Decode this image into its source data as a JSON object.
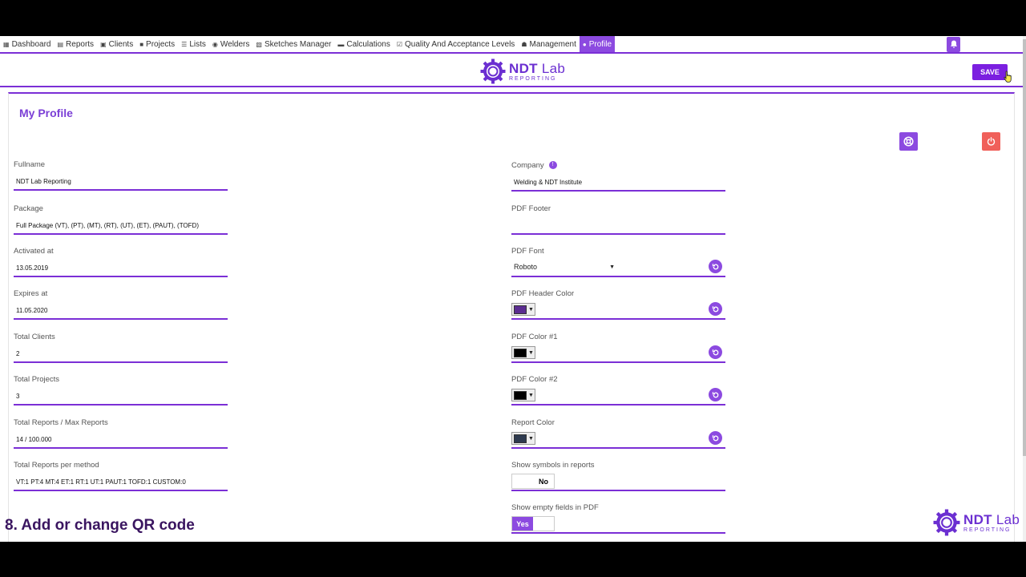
{
  "nav": {
    "items": [
      {
        "label": "Dashboard",
        "icon": "dashboard-icon",
        "active": false
      },
      {
        "label": "Reports",
        "icon": "reports-icon",
        "active": false
      },
      {
        "label": "Clients",
        "icon": "clients-icon",
        "active": false
      },
      {
        "label": "Projects",
        "icon": "projects-icon",
        "active": false
      },
      {
        "label": "Lists",
        "icon": "lists-icon",
        "active": false
      },
      {
        "label": "Welders",
        "icon": "welders-icon",
        "active": false
      },
      {
        "label": "Sketches Manager",
        "icon": "sketches-icon",
        "active": false
      },
      {
        "label": "Calculations",
        "icon": "calculations-icon",
        "active": false
      },
      {
        "label": "Quality And Acceptance Levels",
        "icon": "quality-icon",
        "active": false
      },
      {
        "label": "Management",
        "icon": "management-icon",
        "active": false
      },
      {
        "label": "Profile",
        "icon": "user-icon",
        "active": true
      }
    ],
    "bell_icon": "bell-icon"
  },
  "header": {
    "logo_main_bold": "NDT",
    "logo_main_light": " Lab",
    "logo_sub": "REPORTING",
    "save_label": "SAVE"
  },
  "page": {
    "title": "My Profile"
  },
  "left_fields": {
    "fullname": {
      "label": "Fullname",
      "value": "NDT Lab Reporting"
    },
    "package": {
      "label": "Package",
      "value": "Full Package (VT), (PT), (MT), (RT), (UT), (ET), (PAUT), (TOFD)"
    },
    "activated": {
      "label": "Activated at",
      "value": "13.05.2019"
    },
    "expires": {
      "label": "Expires at",
      "value": "11.05.2020"
    },
    "clients": {
      "label": "Total Clients",
      "value": "2"
    },
    "projects": {
      "label": "Total Projects",
      "value": "3"
    },
    "reports": {
      "label": "Total Reports / Max Reports",
      "value": "14 / 100.000"
    },
    "per_method": {
      "label": "Total Reports per method",
      "value": "VT:1 PT:4 MT:4 ET:1 RT:1 UT:1 PAUT:1 TOFD:1 CUSTOM:0"
    }
  },
  "right_fields": {
    "company": {
      "label": "Company",
      "value": "Welding & NDT Institute",
      "info": "!"
    },
    "pdf_footer": {
      "label": "PDF Footer",
      "value": ""
    },
    "pdf_font": {
      "label": "PDF Font",
      "value": "Roboto"
    },
    "header_color": {
      "label": "PDF Header Color",
      "color": "#5b2c91"
    },
    "color1": {
      "label": "PDF Color #1",
      "color": "#000000"
    },
    "color2": {
      "label": "PDF Color #2",
      "color": "#000000"
    },
    "report_color": {
      "label": "Report Color",
      "color": "#2e3a4f"
    },
    "show_symbols": {
      "label": "Show symbols in reports",
      "state_label": "No",
      "on": false
    },
    "show_empty": {
      "label": "Show empty fields in PDF",
      "state_label": "Yes",
      "on": true
    }
  },
  "caption": "8. Add or change QR code",
  "colors": {
    "accent": "#7b2fd6",
    "danger": "#f0605a"
  }
}
